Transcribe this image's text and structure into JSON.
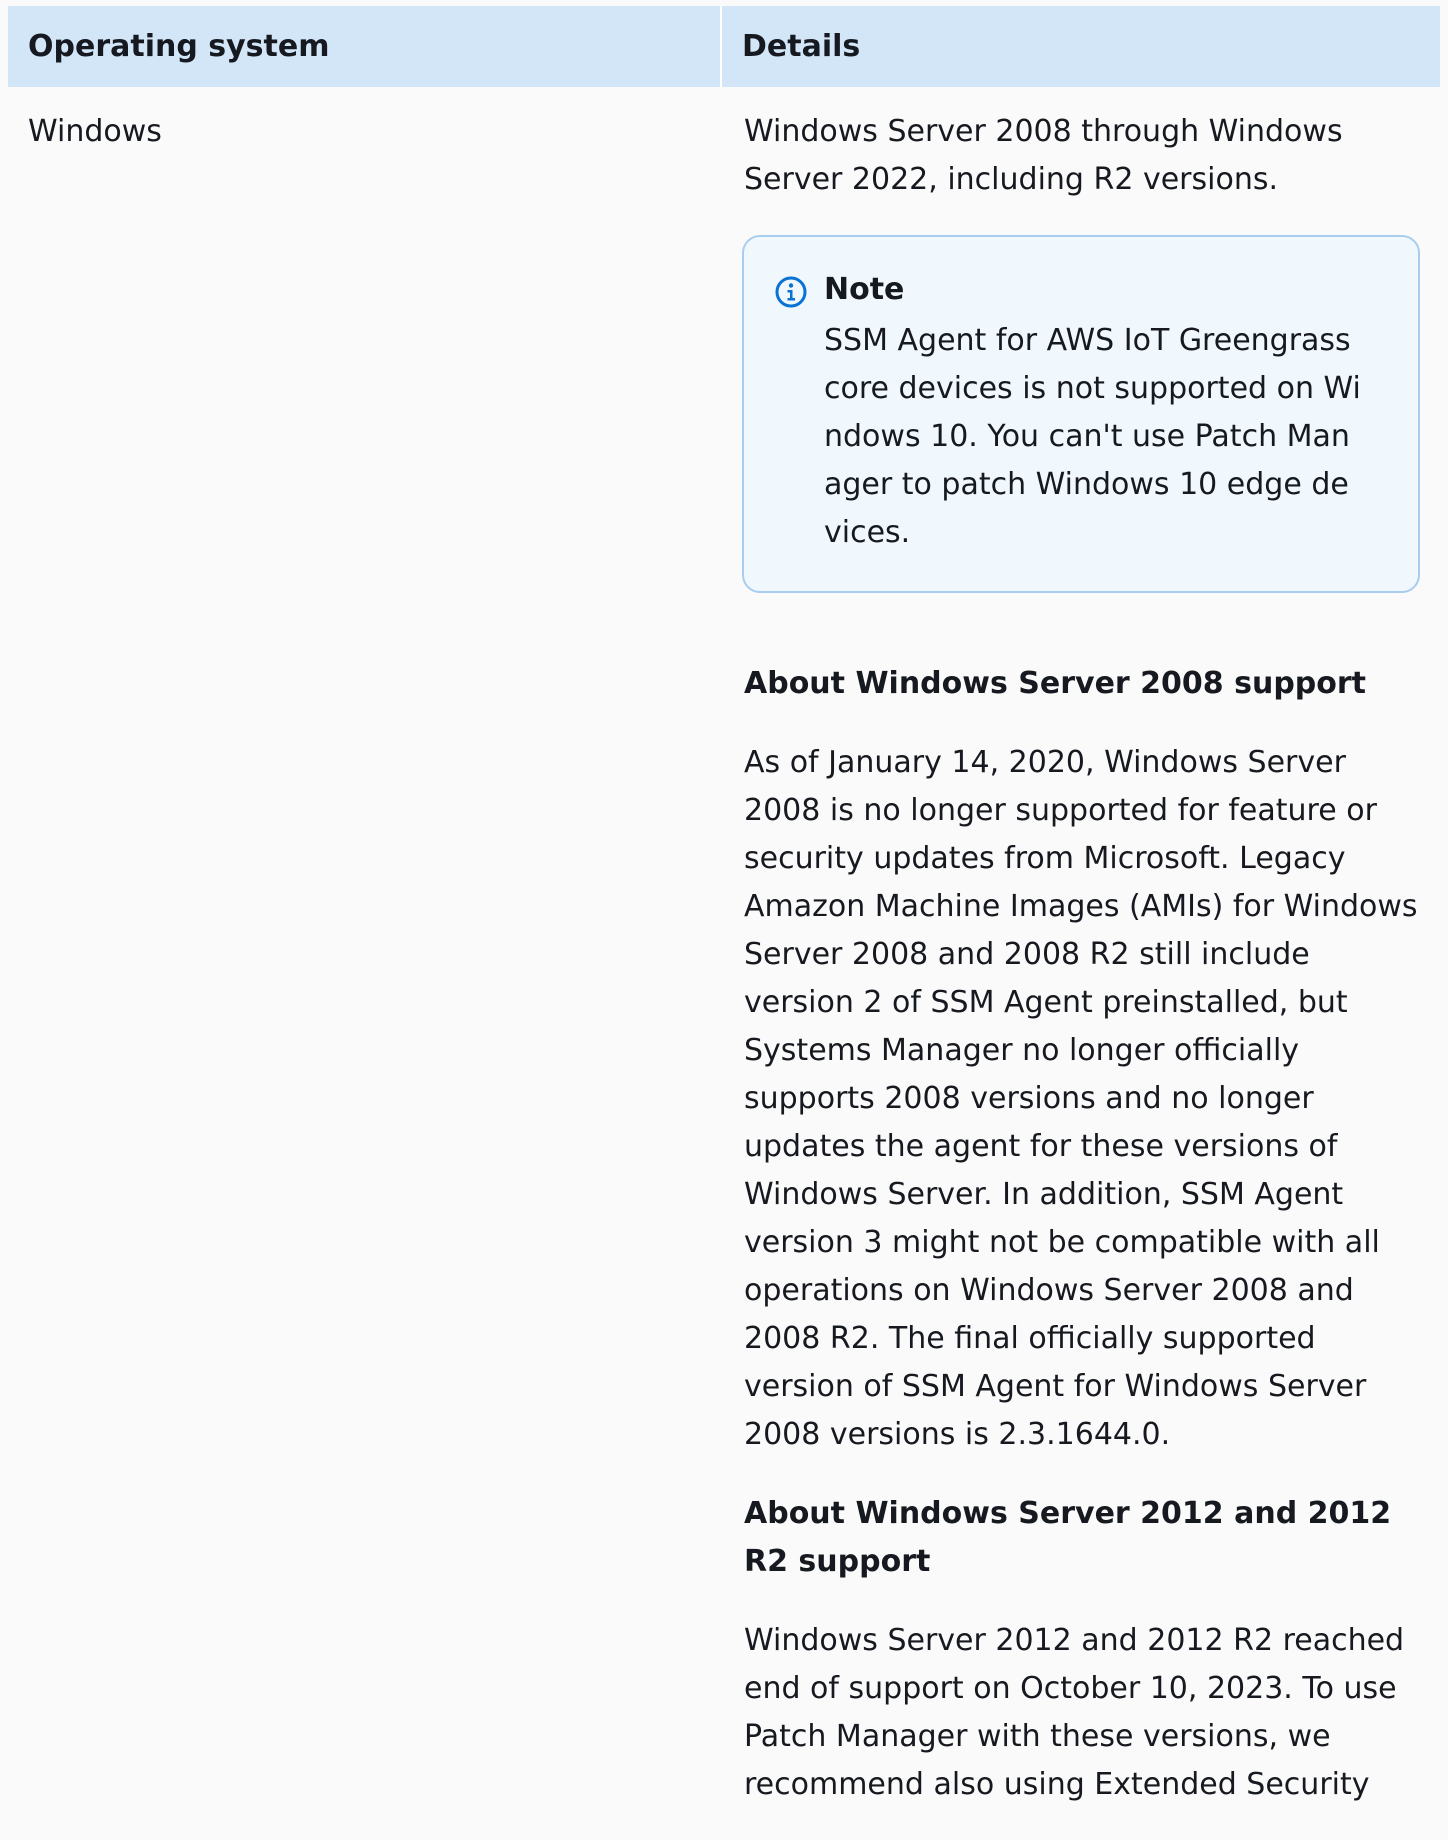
{
  "table": {
    "headers": {
      "operating_system": "Operating system",
      "details": "Details"
    },
    "rows": [
      {
        "os": "Windows",
        "intro": "Windows Server 2008 through Windows Server 2022, including R2 versions.",
        "note": {
          "title": "Note",
          "icon": "info-icon",
          "body": "SSM Agent for AWS IoT Greengrass core devices is not supported on Windows 10. You can't use Patch Manager to patch Windows 10 edge devices."
        },
        "section_2008": {
          "heading": "About Windows Server 2008 support",
          "body": "As of January 14, 2020, Windows Server 2008 is no longer supported for feature or security updates from Microsoft. Legacy Amazon Machine Images (AMIs) for Windows Server 2008 and 2008 R2 still include version 2 of SSM Agent preinstalled, but Systems Manager no longer officially supports 2008 versions and no longer updates the agent for these versions of Windows Server. In addition, SSM Agent version 3 might not be compatible with all operations on Windows Server 2008 and 2008 R2. The final officially supported version of SSM Agent for Windows Server 2008 versions is 2.3.1644.0."
        },
        "section_2012": {
          "heading": "About Windows Server 2012 and 2012 R2 support",
          "body": "Windows Server 2012 and 2012 R2 reached end of support on October 10, 2023. To use Patch Manager with these versions, we recommend also using Extended Security"
        }
      }
    ]
  },
  "colors": {
    "header_bg": "#d2e6f8",
    "note_border": "#a8cdef",
    "note_bg": "#f0f7fd",
    "info_icon": "#0972d3"
  }
}
